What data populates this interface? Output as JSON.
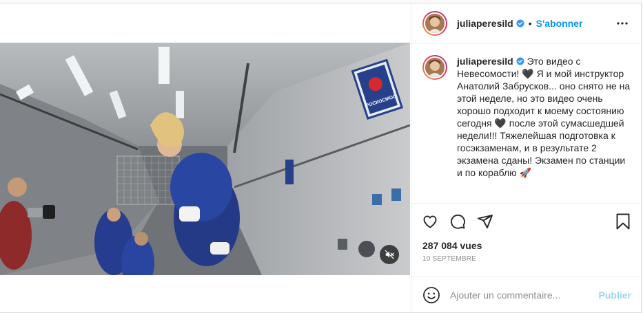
{
  "account": {
    "username": "juliaperesild",
    "follow_label": "S'abonner",
    "separator": "•"
  },
  "caption": {
    "username": "juliaperesild",
    "text": "Это видео с Невесомости! 🖤 Я и мой инструктор Анатолий Забрусков... оно снято не на этой неделе, но это видео очень хорошо подходит к моему состоянию сегодня 🖤 после этой сумасшедшей недели!!! Тяжелейшая подготовка к госэкзаменам, и в результате 2 экзамена сданы! Экзамен по станции и по кораблю 🚀"
  },
  "video": {
    "badge_text": "РОСКОСМОС",
    "muted": true
  },
  "stats": {
    "views": "287 084 vues",
    "date": "10 SEPTEMBRE"
  },
  "comment": {
    "placeholder": "Ajouter un commentaire...",
    "publish_label": "Publier"
  },
  "icons": {
    "more": "more-horizontal-icon",
    "like": "heart-icon",
    "comment": "comment-bubble-icon",
    "share": "paper-plane-icon",
    "save": "bookmark-icon",
    "emoji": "smiley-icon",
    "mute": "speaker-muted-icon",
    "verified": "verified-badge-icon"
  },
  "colors": {
    "accent": "#0095f6",
    "verified": "#3897f0",
    "muted_text": "#8e8e8e"
  }
}
